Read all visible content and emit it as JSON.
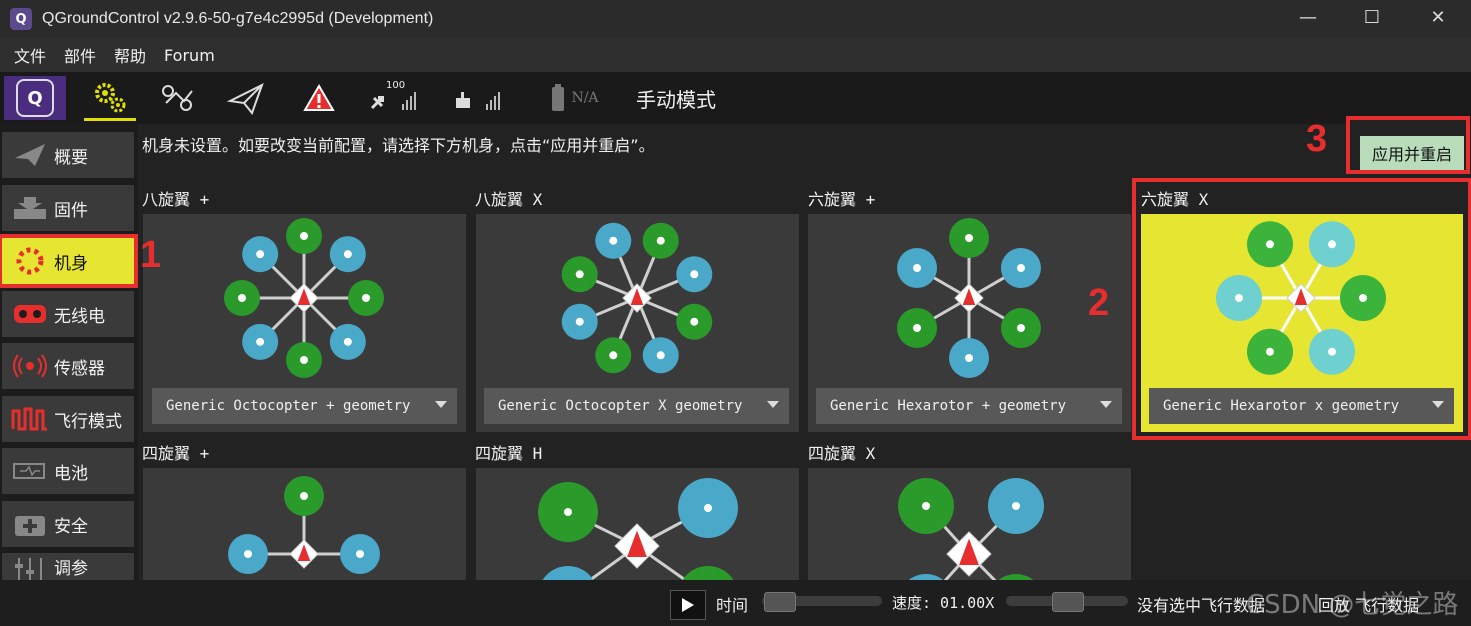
{
  "window": {
    "title": "QGroundControl v2.9.6-50-g7e4c2995d (Development)",
    "min": "—",
    "max": "☐",
    "close": "✕"
  },
  "menu": [
    "文件",
    "部件",
    "帮助",
    "Forum"
  ],
  "toolbar": {
    "satellite_count": "100",
    "battery": "N/A",
    "flight_mode": "手动模式"
  },
  "sidebar": {
    "items": [
      {
        "label": "概要",
        "icon": "paper-plane-icon"
      },
      {
        "label": "固件",
        "icon": "download-icon"
      },
      {
        "label": "机身",
        "icon": "airframe-icon"
      },
      {
        "label": "无线电",
        "icon": "radio-icon"
      },
      {
        "label": "传感器",
        "icon": "sensor-icon"
      },
      {
        "label": "飞行模式",
        "icon": "wave-icon"
      },
      {
        "label": "电池",
        "icon": "battery-icon"
      },
      {
        "label": "安全",
        "icon": "plus-icon"
      },
      {
        "label": "调参",
        "icon": "sliders-icon"
      }
    ]
  },
  "main": {
    "instruction": "机身未设置。如要改变当前配置，请选择下方机身，点击“应用并重启”。",
    "apply_label": "应用并重启",
    "frames": [
      {
        "label": "八旋翼 +",
        "geometry": "Generic Octocopter + geometry"
      },
      {
        "label": "八旋翼 X",
        "geometry": "Generic Octocopter X geometry"
      },
      {
        "label": "六旋翼 +",
        "geometry": "Generic Hexarotor + geometry"
      },
      {
        "label": "六旋翼 X",
        "geometry": "Generic Hexarotor x geometry"
      },
      {
        "label": "四旋翼 +",
        "geometry": ""
      },
      {
        "label": "四旋翼 H",
        "geometry": ""
      },
      {
        "label": "四旋翼 X",
        "geometry": ""
      }
    ]
  },
  "annotations": {
    "m1": "1",
    "m2": "2",
    "m3": "3"
  },
  "bottombar": {
    "time_label": "时间",
    "speed_label": "速度: 01.00X",
    "status": "没有选中飞行数据",
    "replay": "回放 飞行数据"
  },
  "watermark": "CSDN @七觉之路",
  "colors": {
    "accent": "#e6e632",
    "highlight": "#e62e2e",
    "prop_green": "#2a9a2a",
    "prop_blue": "#4aa8c8",
    "apply_bg": "#b9dcbb"
  }
}
